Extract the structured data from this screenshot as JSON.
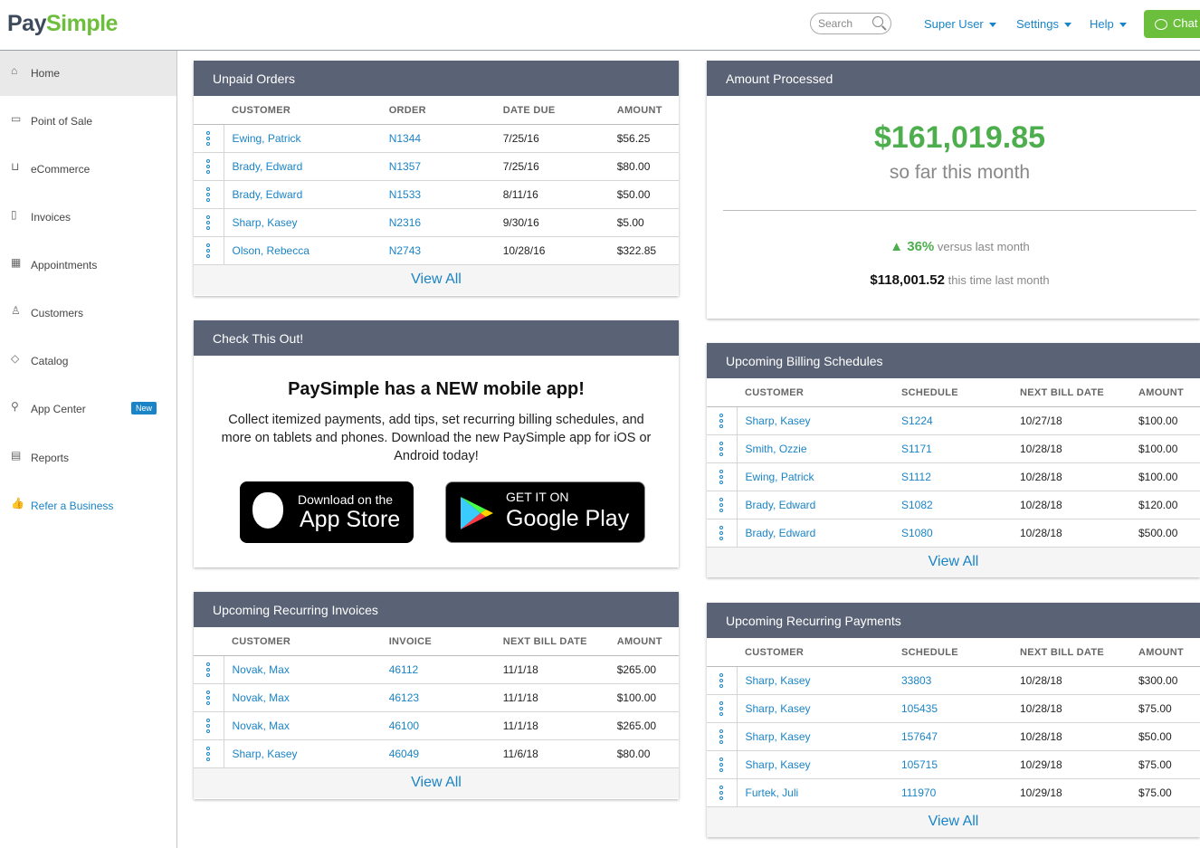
{
  "brand": {
    "part1": "Pay",
    "part2": "Simple"
  },
  "header": {
    "search_placeholder": "Search",
    "user_menu": "Super User",
    "settings": "Settings",
    "help": "Help",
    "chat": "Chat"
  },
  "sidebar": {
    "items": [
      {
        "label": "Home",
        "icon": "home-icon"
      },
      {
        "label": "Point of Sale",
        "icon": "card-icon"
      },
      {
        "label": "eCommerce",
        "icon": "cart-icon"
      },
      {
        "label": "Invoices",
        "icon": "document-icon"
      },
      {
        "label": "Appointments",
        "icon": "calendar-icon"
      },
      {
        "label": "Customers",
        "icon": "user-icon"
      },
      {
        "label": "Catalog",
        "icon": "tag-icon"
      },
      {
        "label": "App Center",
        "icon": "plug-icon",
        "badge": "New"
      },
      {
        "label": "Reports",
        "icon": "report-icon"
      },
      {
        "label": "Refer a Business",
        "icon": "thumbs-up-icon"
      }
    ]
  },
  "unpaid_orders": {
    "title": "Unpaid Orders",
    "headers": [
      "CUSTOMER",
      "ORDER",
      "DATE DUE",
      "AMOUNT"
    ],
    "rows": [
      [
        "Ewing, Patrick",
        "N1344",
        "7/25/16",
        "$56.25"
      ],
      [
        "Brady, Edward",
        "N1357",
        "7/25/16",
        "$80.00"
      ],
      [
        "Brady, Edward",
        "N1533",
        "8/11/16",
        "$50.00"
      ],
      [
        "Sharp, Kasey",
        "N2316",
        "9/30/16",
        "$5.00"
      ],
      [
        "Olson, Rebecca",
        "N2743",
        "10/28/16",
        "$322.85"
      ]
    ],
    "view_all": "View All"
  },
  "promo": {
    "title": "Check This Out!",
    "headline": "PaySimple has a NEW mobile app!",
    "body": "Collect itemized payments, add tips, set recurring billing schedules, and more on tablets and phones. Download the new PaySimple app for iOS or Android today!",
    "app_store_small": "Download on the",
    "app_store_big": "App Store",
    "google_small": "GET IT ON",
    "google_big": "Google Play"
  },
  "recurring_invoices": {
    "title": "Upcoming Recurring Invoices",
    "headers": [
      "CUSTOMER",
      "INVOICE",
      "NEXT BILL DATE",
      "AMOUNT"
    ],
    "rows": [
      [
        "Novak, Max",
        "46112",
        "11/1/18",
        "$265.00"
      ],
      [
        "Novak, Max",
        "46123",
        "11/1/18",
        "$100.00"
      ],
      [
        "Novak, Max",
        "46100",
        "11/1/18",
        "$265.00"
      ],
      [
        "Sharp, Kasey",
        "46049",
        "11/6/18",
        "$80.00"
      ]
    ],
    "view_all": "View All"
  },
  "amount_processed": {
    "title": "Amount Processed",
    "amount": "$161,019.85",
    "subtitle": "so far this month",
    "change": "▲ 36%",
    "change_label": "versus last month",
    "last_amount": "$118,001.52",
    "last_label": "this time last month"
  },
  "billing_schedules": {
    "title": "Upcoming Billing Schedules",
    "headers": [
      "CUSTOMER",
      "SCHEDULE",
      "NEXT BILL DATE",
      "AMOUNT"
    ],
    "rows": [
      [
        "Sharp, Kasey",
        "S1224",
        "10/27/18",
        "$100.00"
      ],
      [
        "Smith, Ozzie",
        "S1171",
        "10/28/18",
        "$100.00"
      ],
      [
        "Ewing, Patrick",
        "S1112",
        "10/28/18",
        "$100.00"
      ],
      [
        "Brady, Edward",
        "S1082",
        "10/28/18",
        "$120.00"
      ],
      [
        "Brady, Edward",
        "S1080",
        "10/28/18",
        "$500.00"
      ]
    ],
    "view_all": "View All"
  },
  "recurring_payments": {
    "title": "Upcoming Recurring Payments",
    "headers": [
      "CUSTOMER",
      "SCHEDULE",
      "NEXT BILL DATE",
      "AMOUNT"
    ],
    "rows": [
      [
        "Sharp, Kasey",
        "33803",
        "10/28/18",
        "$300.00"
      ],
      [
        "Sharp, Kasey",
        "105435",
        "10/28/18",
        "$75.00"
      ],
      [
        "Sharp, Kasey",
        "157647",
        "10/28/18",
        "$50.00"
      ],
      [
        "Sharp, Kasey",
        "105715",
        "10/29/18",
        "$75.00"
      ],
      [
        "Furtek, Juli",
        "111970",
        "10/29/18",
        "$75.00"
      ]
    ],
    "view_all": "View All"
  }
}
